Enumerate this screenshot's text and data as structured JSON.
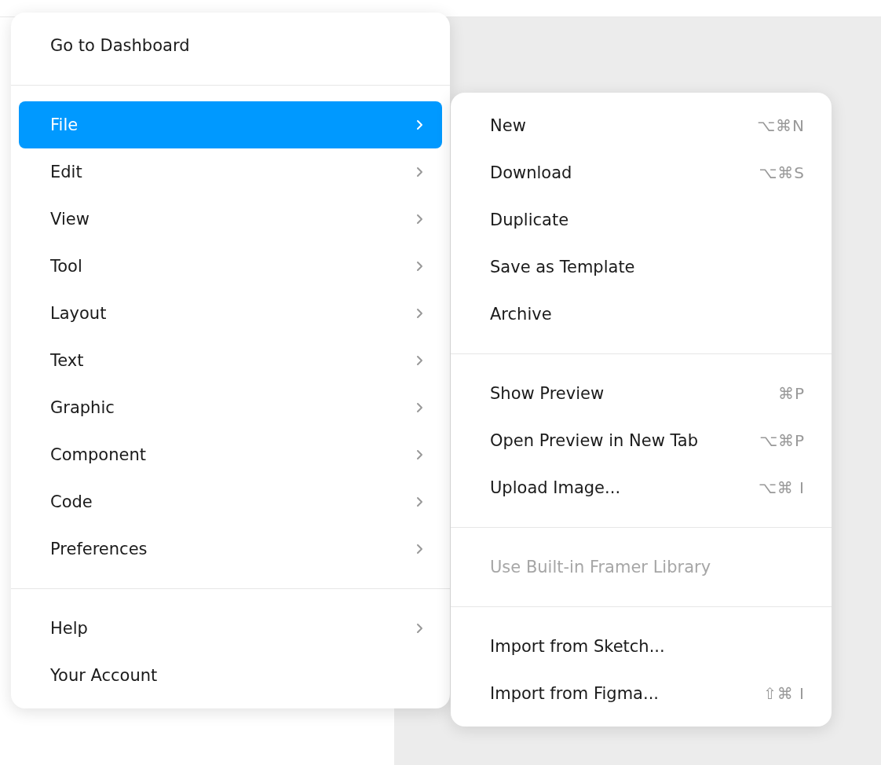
{
  "main_menu": {
    "sections": [
      {
        "items": [
          {
            "label": "Go to Dashboard",
            "has_submenu": false,
            "selected": false
          }
        ]
      },
      {
        "items": [
          {
            "label": "File",
            "has_submenu": true,
            "selected": true
          },
          {
            "label": "Edit",
            "has_submenu": true,
            "selected": false
          },
          {
            "label": "View",
            "has_submenu": true,
            "selected": false
          },
          {
            "label": "Tool",
            "has_submenu": true,
            "selected": false
          },
          {
            "label": "Layout",
            "has_submenu": true,
            "selected": false
          },
          {
            "label": "Text",
            "has_submenu": true,
            "selected": false
          },
          {
            "label": "Graphic",
            "has_submenu": true,
            "selected": false
          },
          {
            "label": "Component",
            "has_submenu": true,
            "selected": false
          },
          {
            "label": "Code",
            "has_submenu": true,
            "selected": false
          },
          {
            "label": "Preferences",
            "has_submenu": true,
            "selected": false
          }
        ]
      },
      {
        "items": [
          {
            "label": "Help",
            "has_submenu": true,
            "selected": false
          },
          {
            "label": "Your Account",
            "has_submenu": false,
            "selected": false
          }
        ]
      }
    ]
  },
  "submenu": {
    "sections": [
      {
        "items": [
          {
            "label": "New",
            "shortcut": "⌥⌘N",
            "disabled": false
          },
          {
            "label": "Download",
            "shortcut": "⌥⌘S",
            "disabled": false
          },
          {
            "label": "Duplicate",
            "disabled": false
          },
          {
            "label": "Save as Template",
            "disabled": false
          },
          {
            "label": "Archive",
            "disabled": false
          }
        ]
      },
      {
        "items": [
          {
            "label": "Show Preview",
            "shortcut": "⌘P",
            "disabled": false
          },
          {
            "label": "Open Preview in New Tab",
            "shortcut": "⌥⌘P",
            "disabled": false
          },
          {
            "label": "Upload Image...",
            "shortcut": "⌥⌘ I",
            "disabled": false
          }
        ]
      },
      {
        "items": [
          {
            "label": "Use Built-in Framer Library",
            "disabled": true
          }
        ]
      },
      {
        "items": [
          {
            "label": "Import from Sketch...",
            "disabled": false
          },
          {
            "label": "Import from Figma...",
            "shortcut": "⇧⌘ I",
            "disabled": false
          }
        ]
      }
    ]
  }
}
